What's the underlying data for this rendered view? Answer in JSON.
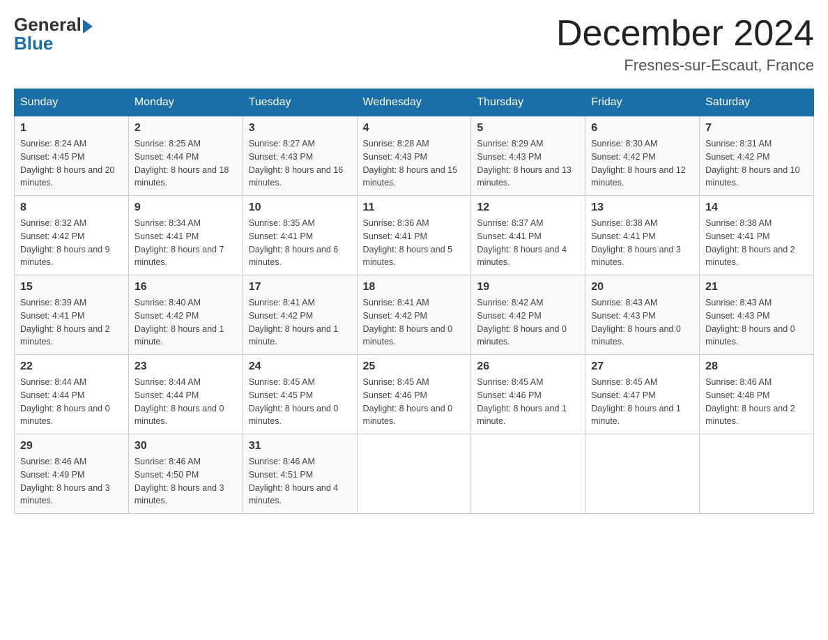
{
  "logo": {
    "general": "General",
    "blue": "Blue"
  },
  "title": {
    "month_year": "December 2024",
    "location": "Fresnes-sur-Escaut, France"
  },
  "weekdays": [
    "Sunday",
    "Monday",
    "Tuesday",
    "Wednesday",
    "Thursday",
    "Friday",
    "Saturday"
  ],
  "weeks": [
    [
      {
        "day": "1",
        "sunrise": "8:24 AM",
        "sunset": "4:45 PM",
        "daylight": "8 hours and 20 minutes."
      },
      {
        "day": "2",
        "sunrise": "8:25 AM",
        "sunset": "4:44 PM",
        "daylight": "8 hours and 18 minutes."
      },
      {
        "day": "3",
        "sunrise": "8:27 AM",
        "sunset": "4:43 PM",
        "daylight": "8 hours and 16 minutes."
      },
      {
        "day": "4",
        "sunrise": "8:28 AM",
        "sunset": "4:43 PM",
        "daylight": "8 hours and 15 minutes."
      },
      {
        "day": "5",
        "sunrise": "8:29 AM",
        "sunset": "4:43 PM",
        "daylight": "8 hours and 13 minutes."
      },
      {
        "day": "6",
        "sunrise": "8:30 AM",
        "sunset": "4:42 PM",
        "daylight": "8 hours and 12 minutes."
      },
      {
        "day": "7",
        "sunrise": "8:31 AM",
        "sunset": "4:42 PM",
        "daylight": "8 hours and 10 minutes."
      }
    ],
    [
      {
        "day": "8",
        "sunrise": "8:32 AM",
        "sunset": "4:42 PM",
        "daylight": "8 hours and 9 minutes."
      },
      {
        "day": "9",
        "sunrise": "8:34 AM",
        "sunset": "4:41 PM",
        "daylight": "8 hours and 7 minutes."
      },
      {
        "day": "10",
        "sunrise": "8:35 AM",
        "sunset": "4:41 PM",
        "daylight": "8 hours and 6 minutes."
      },
      {
        "day": "11",
        "sunrise": "8:36 AM",
        "sunset": "4:41 PM",
        "daylight": "8 hours and 5 minutes."
      },
      {
        "day": "12",
        "sunrise": "8:37 AM",
        "sunset": "4:41 PM",
        "daylight": "8 hours and 4 minutes."
      },
      {
        "day": "13",
        "sunrise": "8:38 AM",
        "sunset": "4:41 PM",
        "daylight": "8 hours and 3 minutes."
      },
      {
        "day": "14",
        "sunrise": "8:38 AM",
        "sunset": "4:41 PM",
        "daylight": "8 hours and 2 minutes."
      }
    ],
    [
      {
        "day": "15",
        "sunrise": "8:39 AM",
        "sunset": "4:41 PM",
        "daylight": "8 hours and 2 minutes."
      },
      {
        "day": "16",
        "sunrise": "8:40 AM",
        "sunset": "4:42 PM",
        "daylight": "8 hours and 1 minute."
      },
      {
        "day": "17",
        "sunrise": "8:41 AM",
        "sunset": "4:42 PM",
        "daylight": "8 hours and 1 minute."
      },
      {
        "day": "18",
        "sunrise": "8:41 AM",
        "sunset": "4:42 PM",
        "daylight": "8 hours and 0 minutes."
      },
      {
        "day": "19",
        "sunrise": "8:42 AM",
        "sunset": "4:42 PM",
        "daylight": "8 hours and 0 minutes."
      },
      {
        "day": "20",
        "sunrise": "8:43 AM",
        "sunset": "4:43 PM",
        "daylight": "8 hours and 0 minutes."
      },
      {
        "day": "21",
        "sunrise": "8:43 AM",
        "sunset": "4:43 PM",
        "daylight": "8 hours and 0 minutes."
      }
    ],
    [
      {
        "day": "22",
        "sunrise": "8:44 AM",
        "sunset": "4:44 PM",
        "daylight": "8 hours and 0 minutes."
      },
      {
        "day": "23",
        "sunrise": "8:44 AM",
        "sunset": "4:44 PM",
        "daylight": "8 hours and 0 minutes."
      },
      {
        "day": "24",
        "sunrise": "8:45 AM",
        "sunset": "4:45 PM",
        "daylight": "8 hours and 0 minutes."
      },
      {
        "day": "25",
        "sunrise": "8:45 AM",
        "sunset": "4:46 PM",
        "daylight": "8 hours and 0 minutes."
      },
      {
        "day": "26",
        "sunrise": "8:45 AM",
        "sunset": "4:46 PM",
        "daylight": "8 hours and 1 minute."
      },
      {
        "day": "27",
        "sunrise": "8:45 AM",
        "sunset": "4:47 PM",
        "daylight": "8 hours and 1 minute."
      },
      {
        "day": "28",
        "sunrise": "8:46 AM",
        "sunset": "4:48 PM",
        "daylight": "8 hours and 2 minutes."
      }
    ],
    [
      {
        "day": "29",
        "sunrise": "8:46 AM",
        "sunset": "4:49 PM",
        "daylight": "8 hours and 3 minutes."
      },
      {
        "day": "30",
        "sunrise": "8:46 AM",
        "sunset": "4:50 PM",
        "daylight": "8 hours and 3 minutes."
      },
      {
        "day": "31",
        "sunrise": "8:46 AM",
        "sunset": "4:51 PM",
        "daylight": "8 hours and 4 minutes."
      },
      null,
      null,
      null,
      null
    ]
  ]
}
